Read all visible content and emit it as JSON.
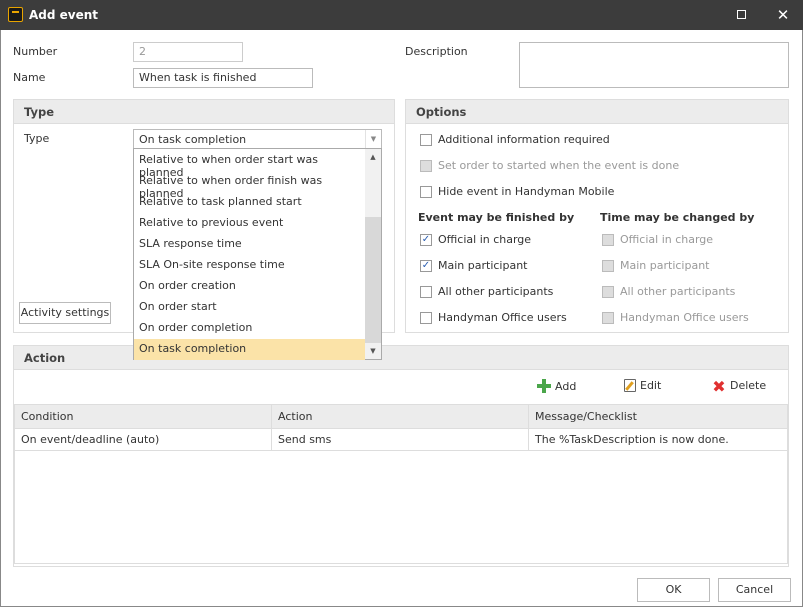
{
  "window": {
    "title": "Add event",
    "maximize_icon": "maximize-icon",
    "close_icon": "close-icon"
  },
  "fields": {
    "number_label": "Number",
    "number_value": "2",
    "name_label": "Name",
    "name_value": "When task is finished",
    "description_label": "Description",
    "description_value": ""
  },
  "type_group": {
    "header": "Type",
    "type_label": "Type",
    "type_value": "On task completion",
    "options": [
      "Relative to when order start was planned",
      "Relative to when order finish was planned",
      "Relative to task planned start",
      "Relative to previous event",
      "SLA response time",
      "SLA On-site response time",
      "On order creation",
      "On order start",
      "On order completion",
      "On task completion"
    ],
    "selected_index": 9,
    "activity_settings_label": "Activity settings"
  },
  "options_group": {
    "header": "Options",
    "checks": [
      {
        "label": "Additional information required",
        "checked": false,
        "enabled": true
      },
      {
        "label": "Set order to started when the event is done",
        "checked": false,
        "enabled": false
      },
      {
        "label": "Hide event in Handyman Mobile",
        "checked": false,
        "enabled": true
      }
    ],
    "finished_by_header": "Event may be finished by",
    "finished_by": [
      {
        "label": "Official in charge",
        "checked": true
      },
      {
        "label": "Main participant",
        "checked": true
      },
      {
        "label": "All other participants",
        "checked": false
      },
      {
        "label": "Handyman Office users",
        "checked": false
      }
    ],
    "changed_by_header": "Time may be changed by",
    "changed_by": [
      {
        "label": "Official in charge",
        "checked": false
      },
      {
        "label": "Main participant",
        "checked": false
      },
      {
        "label": "All other participants",
        "checked": false
      },
      {
        "label": "Handyman Office users",
        "checked": false
      }
    ]
  },
  "action_group": {
    "header": "Action",
    "toolbar": {
      "add_label": "Add",
      "edit_label": "Edit",
      "delete_label": "Delete"
    },
    "columns": [
      "Condition",
      "Action",
      "Message/Checklist"
    ],
    "rows": [
      [
        "On event/deadline (auto)",
        "Send sms",
        "The %TaskDescription is now done."
      ]
    ]
  },
  "footer": {
    "ok_label": "OK",
    "cancel_label": "Cancel"
  }
}
